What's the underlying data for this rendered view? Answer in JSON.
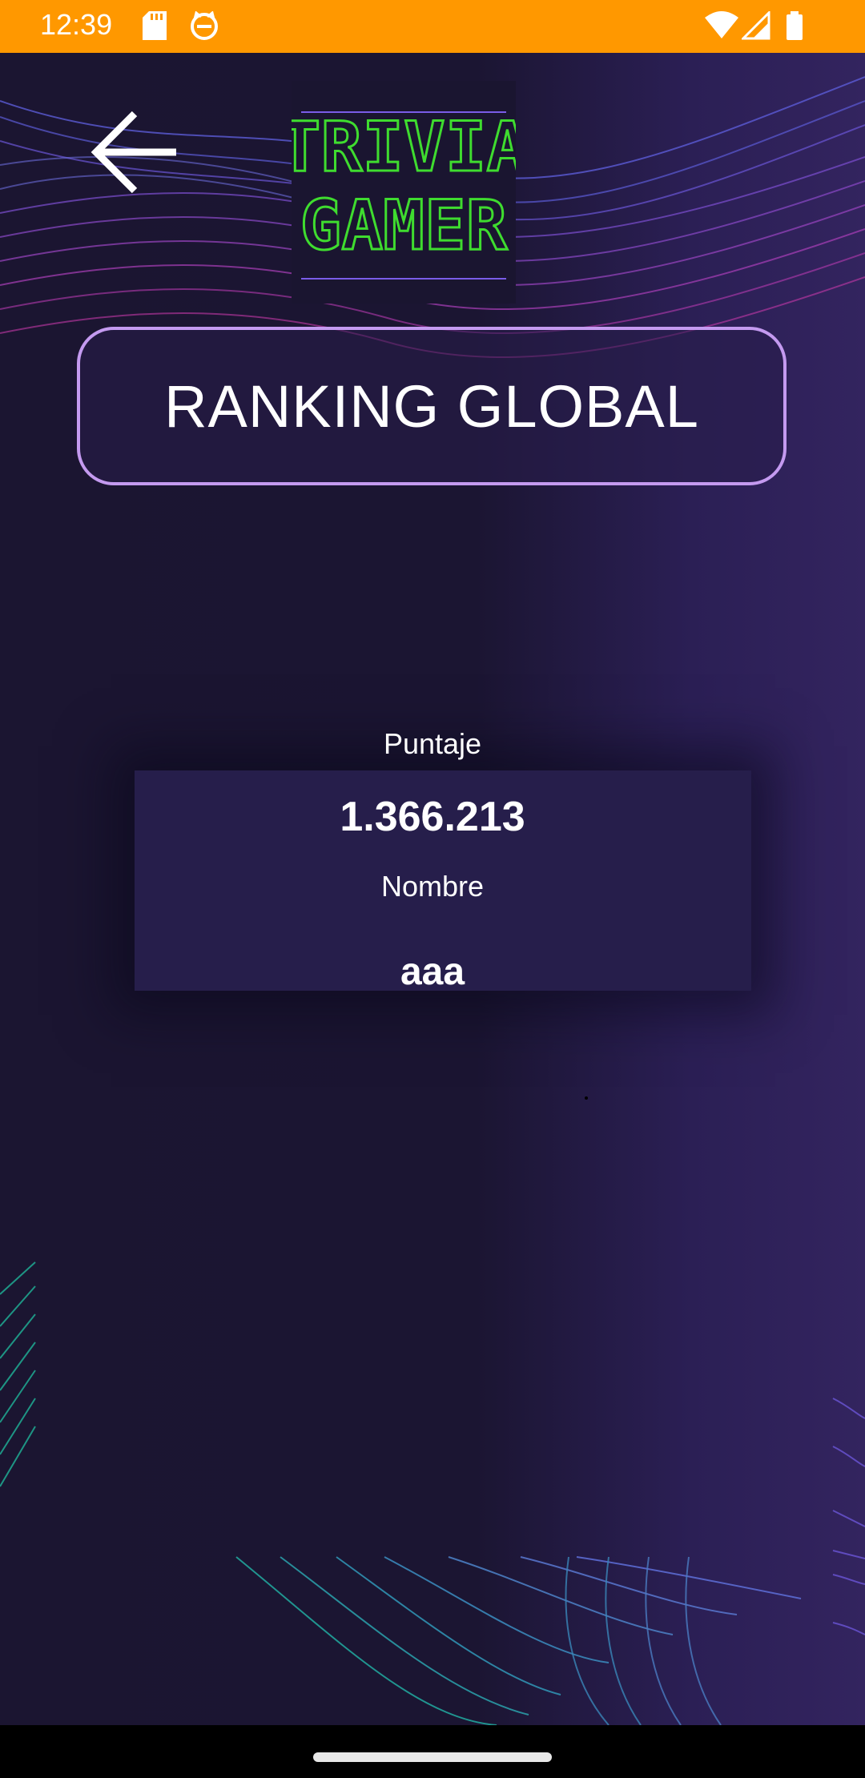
{
  "status_bar": {
    "time": "12:39",
    "icons": [
      "sd-card-icon",
      "cat-face-icon",
      "wifi-icon",
      "signal-icon",
      "battery-icon"
    ],
    "color": "#FF9800"
  },
  "header": {
    "back_icon": "arrow-left-icon",
    "logo": {
      "line1": "TRIVIA",
      "line2": "GAMER",
      "color": "#3fdc2f"
    }
  },
  "title": {
    "text": "RANKING GLOBAL",
    "border_color": "#c49af0"
  },
  "ranking": {
    "score_label": "Puntaje",
    "score_value": "1.366.213",
    "name_label": "Nombre",
    "name_value": "aaa"
  },
  "nav_bar": {
    "home_indicator": "home-indicator"
  }
}
